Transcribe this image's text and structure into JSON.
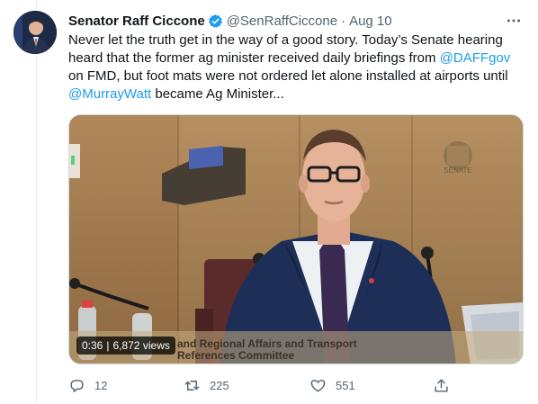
{
  "tweet": {
    "author_name": "Senator Raff Ciccone",
    "handle": "@SenRaffCiccone",
    "separator": "·",
    "date": "Aug 10",
    "more_icon": "more-horizontal-icon",
    "verified_icon": "verified-badge-icon",
    "text_parts": {
      "p1": "Never let the truth get in the way of a good story. Today’s Senate hearing heard that the former ag minister received daily briefings from ",
      "m1": "@DAFFgov",
      "p2": " on FMD, but foot mats were not ordered let alone installed at airports until ",
      "m2": "@MurrayWatt",
      "p3": " became Ag Minister..."
    }
  },
  "media": {
    "duration": "0:36",
    "views": "6,872 views",
    "caption_line1": "and Regional Affairs and Transport",
    "caption_line2": "References Committee",
    "crest_label": "SENATE"
  },
  "actions": {
    "reply_count": "12",
    "retweet_count": "225",
    "like_count": "551",
    "reply_icon": "reply-icon",
    "retweet_icon": "retweet-icon",
    "like_icon": "heart-icon",
    "share_icon": "share-icon"
  },
  "colors": {
    "accent": "#1d9bf0",
    "verified": "#1d9bf0",
    "secondary_text": "#536471",
    "primary_text": "#0f1419"
  }
}
